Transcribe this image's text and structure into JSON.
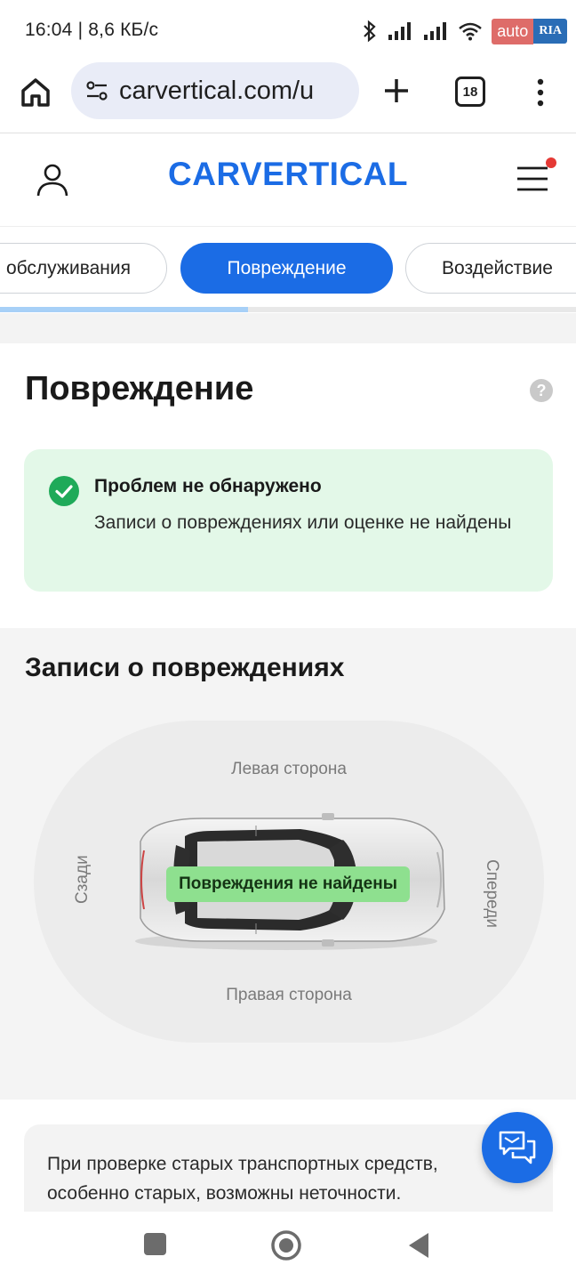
{
  "status_bar": {
    "time_speed": "16:04 | 8,6 КБ/с",
    "badge_auto": "auto",
    "badge_ria": "RIA"
  },
  "browser": {
    "url": "carvertical.com/u",
    "tab_count": "18"
  },
  "site": {
    "logo": "CARVERTICAL"
  },
  "section_tabs": [
    {
      "label": "обслуживания",
      "active": false
    },
    {
      "label": "Повреждение",
      "active": true
    },
    {
      "label": "Воздействие",
      "active": false
    }
  ],
  "scroll_progress": 0.43,
  "damage": {
    "title": "Повреждение",
    "help": "?",
    "status_heading": "Проблем не обнаружено",
    "status_description": "Записи о повреждениях или оценке не найдены"
  },
  "records": {
    "title": "Записи о повреждениях",
    "left_side": "Левая сторона",
    "right_side": "Правая сторона",
    "rear": "Сзади",
    "front": "Спереди",
    "no_damage": "Повреждения не найдены"
  },
  "note": {
    "text": "При проверке старых транспортных средств, особенно старых, возможны неточности."
  },
  "colors": {
    "brand_blue": "#1b6ce5",
    "success_bg": "#e3f8e8",
    "success_green": "#1faa59",
    "pill_green": "#8ee08f"
  }
}
